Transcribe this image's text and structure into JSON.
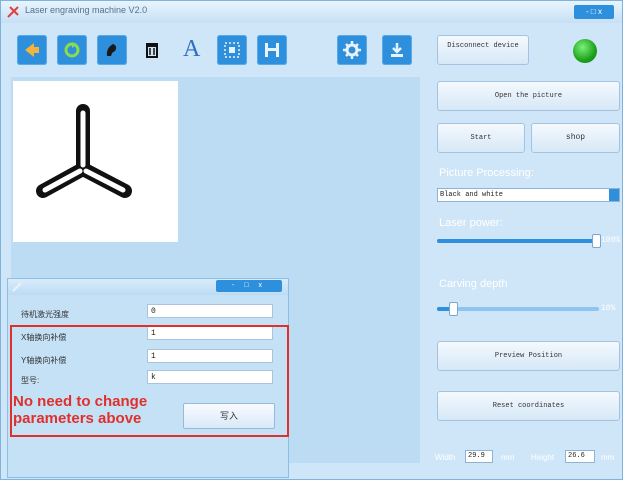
{
  "window": {
    "title": "Laser engraving machine V2.0",
    "controls": "- □ x"
  },
  "toolbar": {
    "icons": [
      "arrow-icon",
      "refresh-icon",
      "paint-icon",
      "trash-icon",
      "text-icon",
      "crop-icon",
      "save-icon",
      "settings-icon",
      "download-icon"
    ],
    "text_icon_glyph": "A"
  },
  "right": {
    "disconnect_label": "Disconnect device",
    "open_picture_label": "Open the picture",
    "start_label": "Start",
    "shop_label": "shop",
    "picture_processing_label": "Picture Processing:",
    "picture_processing_value": "Black and white",
    "laser_power_label": "Laser power:",
    "laser_power_pct": "100%",
    "laser_power_level": 0.98,
    "carving_depth_label": "Carving depth",
    "carving_depth_pct": "10%",
    "carving_depth_level": 0.1,
    "preview_label": "Preview Position",
    "reset_label": "Reset coordinates",
    "width_label": "Width",
    "width_value": "29.9",
    "width_unit": "mm",
    "height_label": "Height",
    "height_value": "26.6",
    "height_unit": "mm"
  },
  "dialog": {
    "controls": "- □ x",
    "params": [
      {
        "label": "待机激光强度",
        "value": "0"
      },
      {
        "label": "X轴换向补偿",
        "value": "1"
      },
      {
        "label": "Y轴换向补偿",
        "value": "1"
      },
      {
        "label": "型号:",
        "value": "k"
      }
    ],
    "write_label": "写入"
  },
  "annotation": {
    "text": "No need to change parameters above",
    "color": "#e0302c"
  },
  "colors": {
    "accent": "#2e8fdc",
    "window_bg": "#cfe6f8",
    "status_ok": "#1ea31c"
  }
}
